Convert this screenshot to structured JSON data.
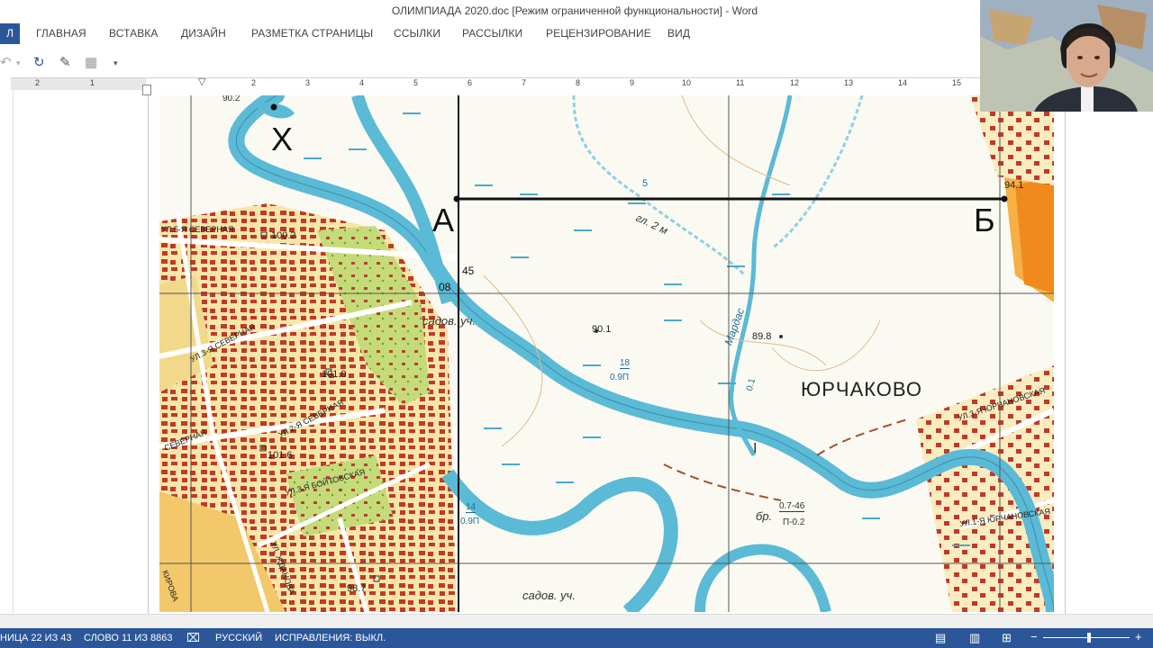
{
  "window": {
    "title": "ОЛИМПИАДА 2020.doc [Режим ограниченной функциональности] - Word"
  },
  "ribbon": {
    "file_tab": "Л",
    "tabs": [
      "ГЛАВНАЯ",
      "ВСТАВКА",
      "ДИЗАЙН",
      "РАЗМЕТКА СТРАНИЦЫ",
      "ССЫЛКИ",
      "РАССЫЛКИ",
      "РЕЦЕНЗИРОВАНИЕ",
      "ВИД"
    ]
  },
  "ruler": {
    "numbers": [
      "2",
      "1",
      "1",
      "2",
      "3",
      "4",
      "5",
      "6",
      "7",
      "8",
      "9",
      "10",
      "11",
      "12",
      "13",
      "14",
      "15"
    ]
  },
  "map": {
    "point_x": "Х",
    "point_a": "А",
    "point_b": "Б",
    "elev_b": "94.1",
    "elev_1002": "100.2",
    "elev_1010": "101.0",
    "elev_1016": "101.6",
    "elev_987": "98.7",
    "elev_901": "90.1",
    "elev_898": "89.8",
    "village": "ЮРЧАКОВО",
    "river": "Мардас",
    "gully": "гл. 2 м",
    "garden1": "садов. уч.",
    "garden2": "садов. уч.",
    "ford_label": "бр.",
    "ford_num": "0.7-46",
    "ford_den": "П-0.2",
    "depth1_num": "18",
    "depth1_den": "0.9П",
    "depth2_num": "14",
    "depth2_den": "0.9П",
    "num45": "45",
    "num08": "08",
    "num5": "5",
    "num01": "0.1",
    "top_label": "90.2",
    "street_5": "УЛ.5-Я СЕВЕРНАЯ",
    "street_3": "УЛ.3-Я СЕВЕРНАЯ",
    "street_2": "УЛ.2-Я СЕВЕРНАЯ",
    "street_sev": "СЕВЕРНАЯ",
    "street_boyt": "УЛ.3.Я БОЙТОВСКАЯ",
    "street_zhd": "УЛ. ЖДАНОВА",
    "street_yur3": "УЛ.3-Я ЮРЧАНОВСКАЯ",
    "street_yur1": "УЛ.1-Я ЮРЧАНОВСКАЯ",
    "street_kir": "КИРОВА"
  },
  "status": {
    "page": "НИЦА 22 ИЗ 43",
    "words": "СЛОВО 11 ИЗ 8863",
    "lang": "РУССКИЙ",
    "track": "ИСПРАВЛЕНИЯ: ВЫКЛ."
  },
  "colors": {
    "accent": "#2b579a",
    "water": "#5bbad5",
    "building": "#c0392b",
    "urban": "#f6e49a",
    "green": "#b9d56a"
  }
}
